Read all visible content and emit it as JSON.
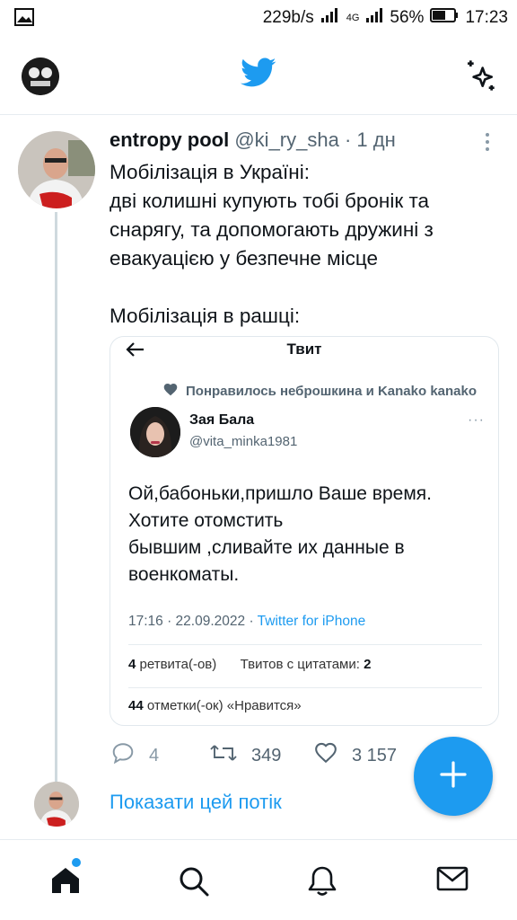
{
  "status_bar": {
    "speed": "229b/s",
    "network": "4G",
    "battery": "56%",
    "time": "17:23"
  },
  "header": {
    "logo_icon": "twitter-bird-icon",
    "sparkle_icon": "sparkle-icon"
  },
  "tweet": {
    "name": "entropy pool",
    "handle": "@ki_ry_sha",
    "separator": "·",
    "time": "1 дн",
    "lines": [
      "Мобілізація в Україні:",
      "дві колишні купують тобі бронік та",
      "снарягу, та допомогають дружині з",
      "евакуацією у безпечне місце",
      "",
      "Мобілізація в рашці:"
    ],
    "stats": {
      "replies": "4",
      "retweets": "349",
      "likes": "3 157"
    }
  },
  "embedded": {
    "title": "Твит",
    "liked_by": "Понравилось неброшкина и Kanako kanako",
    "name": "Зая Бала",
    "handle": "@vita_minka1981",
    "more": "···",
    "lines": [
      "Ой,бабоньки,пришло Ваше время.",
      "Хотите отомстить",
      "бывшим ,сливайте их данные в",
      "военкоматы."
    ],
    "meta_time": "17:16 · 22.09.2022 · ",
    "meta_source": "Twitter for iPhone",
    "retweets_count": "4",
    "retweets_label": " ретвита(-ов)",
    "quotes_label": "Твитов с цитатами: ",
    "quotes_count": "2",
    "likes_count": "44",
    "likes_label": " отметки(-ок) «Нравится»"
  },
  "show_thread": "Показати цей потік",
  "colors": {
    "accent": "#1d9bf0",
    "text": "#0f1419",
    "muted": "#536471"
  }
}
